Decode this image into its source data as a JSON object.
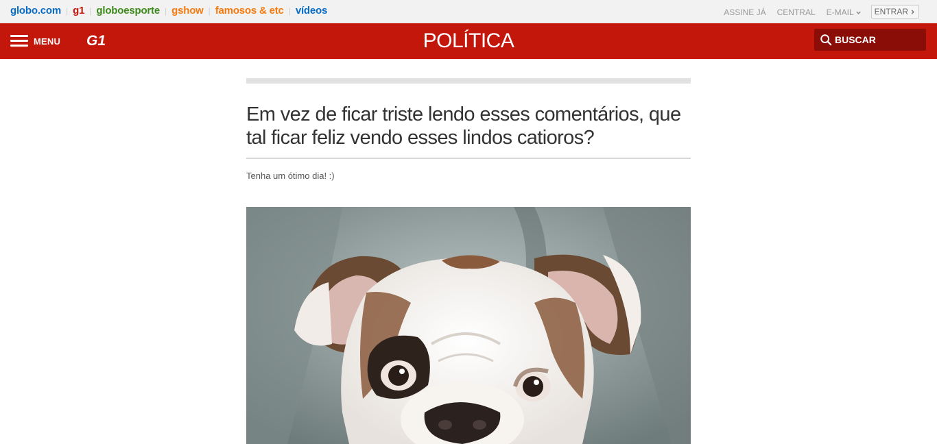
{
  "topbar": {
    "brands": [
      {
        "label": "globo.com",
        "color": "#0a6bc2"
      },
      {
        "label": "g1",
        "color": "#c4170c"
      },
      {
        "label": "globoesporte",
        "color": "#3c8a1c"
      },
      {
        "label": "gshow",
        "color": "#f27a0f"
      },
      {
        "label": "famosos & etc",
        "color": "#f27a0f"
      },
      {
        "label": "vídeos",
        "color": "#0a6bc2"
      }
    ],
    "links": {
      "subscribe": "ASSINE JÁ",
      "central": "CENTRAL",
      "email": "E-MAIL",
      "login": "ENTRAR"
    }
  },
  "header": {
    "menu_label": "MENU",
    "logo_text": "G1",
    "section_title": "POLÍTICA",
    "search_label": "BUSCAR",
    "background_color": "#c4170c"
  },
  "article": {
    "headline": "Em vez de ficar triste lendo esses comentários, que tal ficar feliz vendo esses lindos catioros?",
    "subtitle": "Tenha um ótimo dia! :)",
    "image_subject": "bulldog-puppy-photo"
  }
}
